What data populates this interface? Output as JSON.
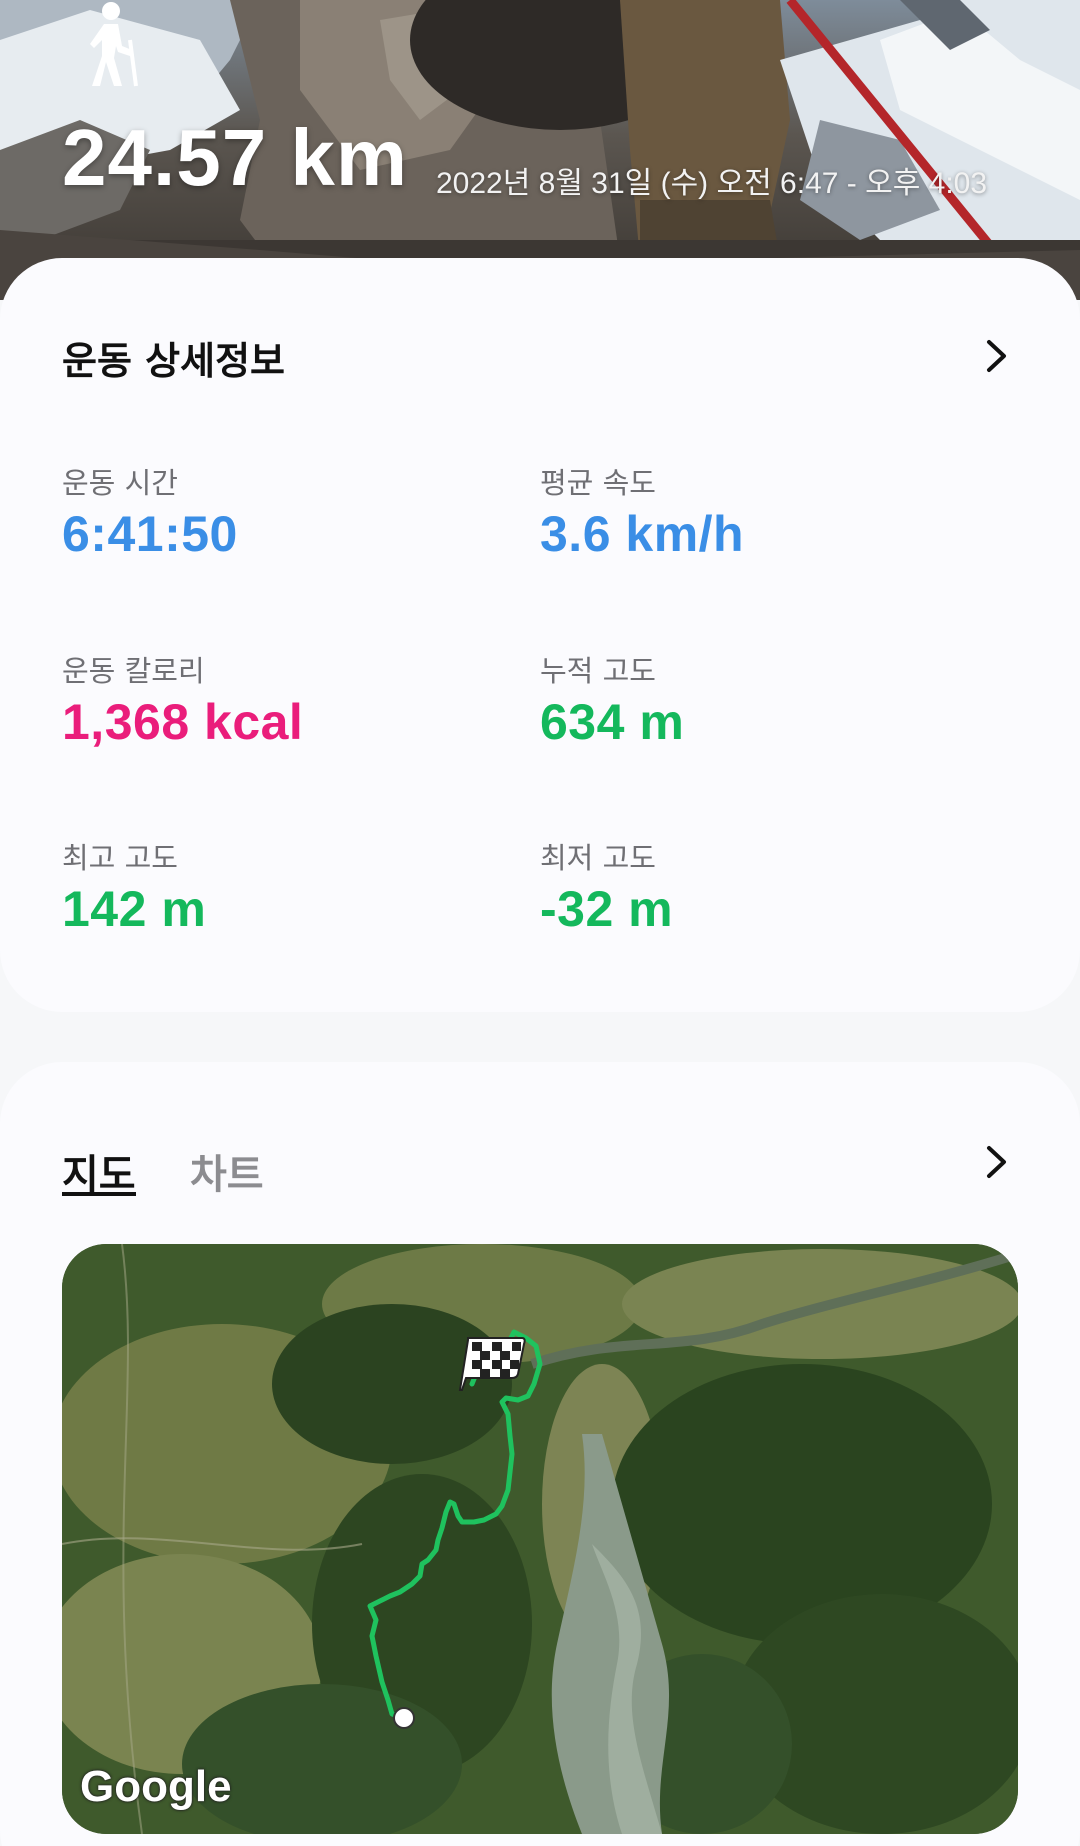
{
  "hero": {
    "activity_icon": "hiking-icon",
    "distance": "24.57 km",
    "datetime": "2022년 8월 31일 (수) 오전 6:47 - 오후 4:03"
  },
  "details": {
    "title": "운동 상세정보",
    "chevron_icon": "chevron-right-icon",
    "stats": {
      "duration": {
        "label": "운동 시간",
        "value": "6:41:50"
      },
      "avg_speed": {
        "label": "평균 속도",
        "value": "3.6 km/h"
      },
      "calories": {
        "label": "운동 칼로리",
        "value": "1,368 kcal"
      },
      "elevation_gain": {
        "label": "누적 고도",
        "value": "634 m"
      },
      "max_altitude": {
        "label": "최고 고도",
        "value": "142 m"
      },
      "min_altitude": {
        "label": "최저 고도",
        "value": "-32 m"
      }
    }
  },
  "map_section": {
    "tabs": [
      {
        "label": "지도",
        "selected": true
      },
      {
        "label": "차트",
        "selected": false
      }
    ],
    "chevron_icon": "chevron-right-icon",
    "map_attribution": "Google",
    "route_color": "#1fc25e",
    "finish_icon": "checkered-flag-icon",
    "start_icon": "start-point-icon"
  },
  "colors": {
    "time_speed": "#3a8ee6",
    "calories": "#ea1d7b",
    "altitude": "#14b85c"
  }
}
